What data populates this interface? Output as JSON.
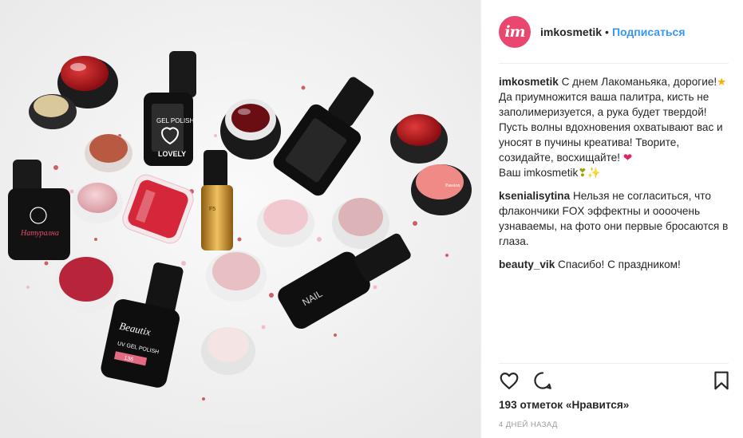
{
  "photo": {
    "alt_subject": "nail-polish-products"
  },
  "header": {
    "username": "imkosmetik",
    "separator": "•",
    "follow_label": "Подписаться",
    "avatar_letters": "im"
  },
  "caption": {
    "username": "imkosmetik",
    "text_1": " С днем Лакоманьяка, дорогие!",
    "star": "★",
    "text_2": " Да приумножится ваша палитра, кисть не заполимеризуется, а рука будет твердой! Пусть волны вдохновения охватывают вас и уносят в пучины креатива! Творите, созидайте, восхищайте! ",
    "heart": "❤",
    "text_3": "Ваш imkosmetik",
    "emoji_tail": "❣✨"
  },
  "comments": [
    {
      "username": "ksenialisytina",
      "text": " Нельзя не согласиться, что флакончики FOX эффектны и оооочень узнаваемы, на фото они первые бросаются в глаза."
    },
    {
      "username": "beauty_vik",
      "text": " Спасибо! С праздником!"
    }
  ],
  "likes": {
    "text": "193 отметок «Нравится»"
  },
  "timestamp": {
    "text": "4 ДНЕЙ НАЗАД"
  },
  "colors": {
    "accent_blue": "#3897f0",
    "avatar_pink": "#e8476f"
  }
}
